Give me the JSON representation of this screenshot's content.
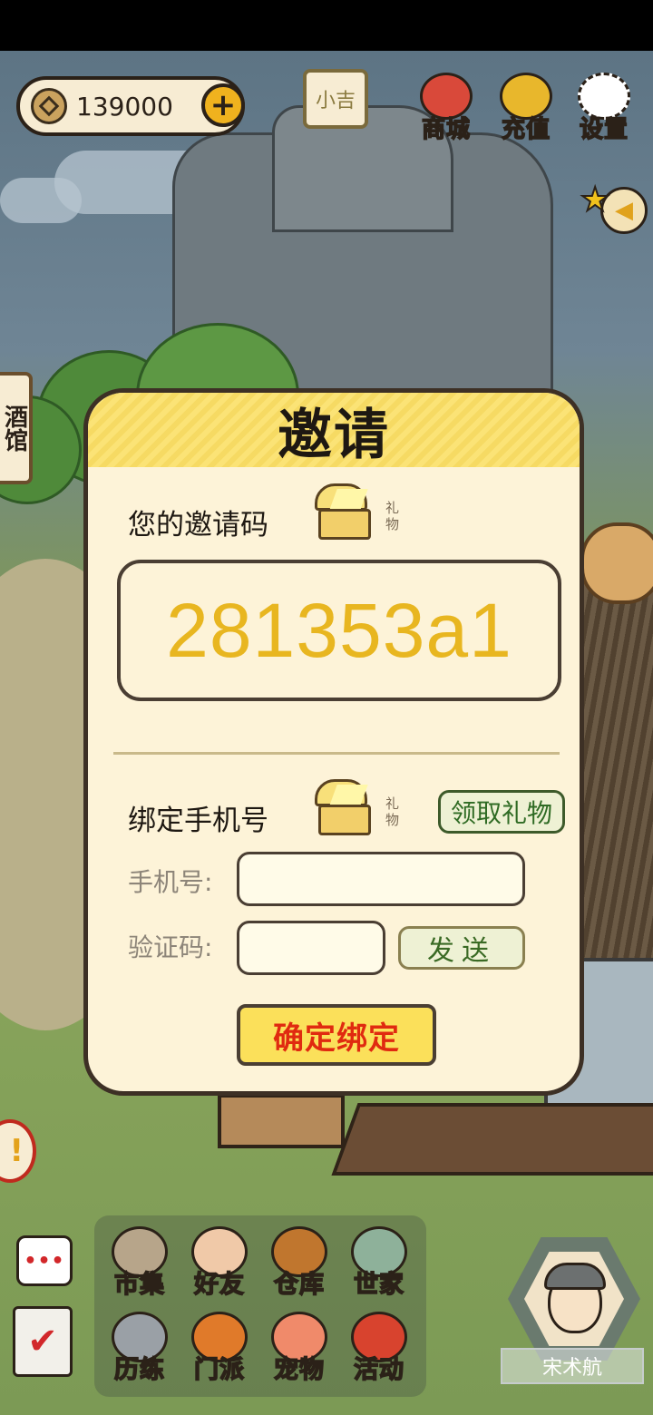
{
  "hud": {
    "coins": "139000",
    "plus": "+",
    "name_tag": "小吉",
    "buttons": [
      {
        "label": "商城",
        "icon": "money-bag-icon",
        "color": "#d9493a"
      },
      {
        "label": "充值",
        "icon": "gold-ingot-icon",
        "color": "#e8b72c"
      },
      {
        "label": "设置",
        "icon": "gear-icon",
        "color": "#ffffff"
      }
    ],
    "star": "★",
    "arrow": "◀"
  },
  "side_tag": "酒馆",
  "modal": {
    "title": "邀请",
    "invite_label": "您的邀请码",
    "gift_text": "礼物",
    "invite_code": "281353a1",
    "bind_label": "绑定手机号",
    "claim_button": "领取礼物",
    "phone_label": "手机号:",
    "phone_value": "",
    "code_label": "验证码:",
    "code_value": "",
    "send_button": "发送",
    "confirm_button": "确定绑定"
  },
  "dock": [
    {
      "label": "市集",
      "icon": "market-icon",
      "color": "#b7a58a"
    },
    {
      "label": "好友",
      "icon": "handshake-icon",
      "color": "#f0c9a8"
    },
    {
      "label": "仓库",
      "icon": "treasure-chest-icon",
      "color": "#c0762e"
    },
    {
      "label": "世家",
      "icon": "helmet-icon",
      "color": "#8eb19a"
    },
    {
      "label": "历练",
      "icon": "crossed-swords-icon",
      "color": "#9aa0a6"
    },
    {
      "label": "门派",
      "icon": "banner-icon",
      "color": "#e07a2a"
    },
    {
      "label": "宠物",
      "icon": "paw-icon",
      "color": "#f08a6a"
    },
    {
      "label": "活动",
      "icon": "lantern-icon",
      "color": "#d8432e"
    }
  ],
  "chat_icon_text": "•••",
  "task_icon_text": "✔",
  "alert_text": "!",
  "player_name": "宋术航"
}
